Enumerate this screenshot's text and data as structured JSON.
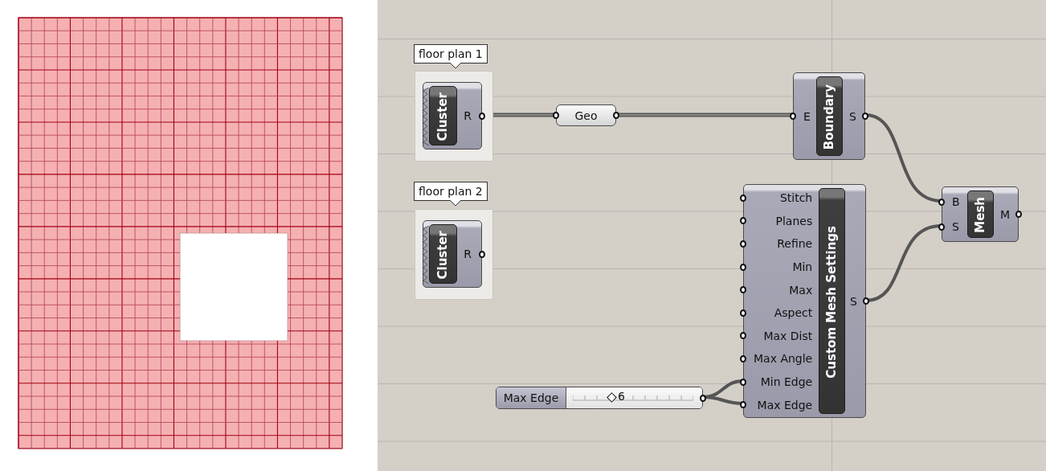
{
  "nodes": [
    {
      "kind": "cluster",
      "group": "floor plan 1",
      "title": "Cluster",
      "outputs": [
        "R"
      ]
    },
    {
      "kind": "cluster",
      "group": "floor plan 2",
      "title": "Cluster",
      "outputs": [
        "R"
      ]
    },
    {
      "kind": "param",
      "title": "Geo"
    },
    {
      "kind": "component",
      "title": "Boundary",
      "inputs": [
        "E"
      ],
      "outputs": [
        "S"
      ]
    },
    {
      "kind": "component",
      "title": "Custom Mesh Settings",
      "inputs": [
        "Stitch",
        "Planes",
        "Refine",
        "Min",
        "Max",
        "Aspect",
        "Max Dist",
        "Max Angle",
        "Min Edge",
        "Max Edge"
      ],
      "outputs": [
        "S"
      ]
    },
    {
      "kind": "component",
      "title": "Mesh",
      "inputs": [
        "B",
        "S"
      ],
      "outputs": [
        "M"
      ]
    },
    {
      "kind": "slider",
      "title": "Max Edge",
      "value": "6",
      "level": 0.32
    }
  ]
}
